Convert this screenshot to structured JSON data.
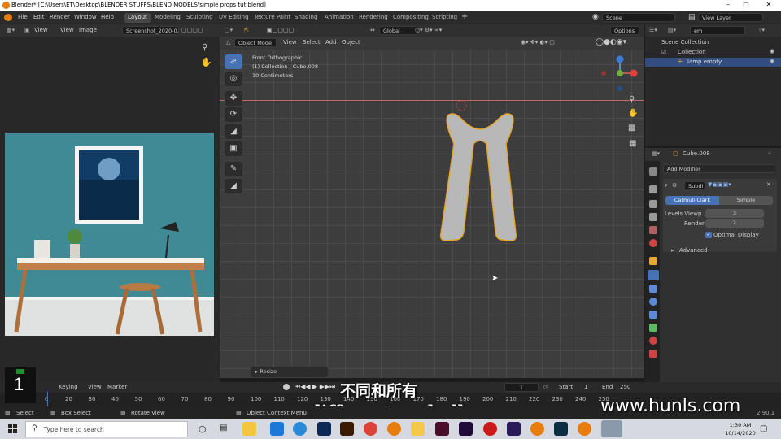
{
  "window": {
    "title": "Blender* [C:\\Users\\ET\\Desktop\\BLENDER STUFFS\\BLEND MODELS\\simple props tut.blend]"
  },
  "menu": [
    "File",
    "Edit",
    "Render",
    "Window",
    "Help"
  ],
  "workspaces": [
    "Layout",
    "Modeling",
    "Sculpting",
    "UV Editing",
    "Texture Paint",
    "Shading",
    "Animation",
    "Rendering",
    "Compositing",
    "Scripting"
  ],
  "scene": {
    "label": "Scene",
    "view_layer": "View Layer"
  },
  "image_editor": {
    "menus": [
      "View",
      "View",
      "Image"
    ],
    "image_name": "Screenshot_2020-0..."
  },
  "viewport": {
    "mode": "Object Mode",
    "menus": [
      "View",
      "Select",
      "Add",
      "Object"
    ],
    "orientation": "Global",
    "options": "Options",
    "info": [
      "Front Orthographic",
      "(1) Collection | Cube.008",
      "10 Centimeters"
    ],
    "operator": "Resize"
  },
  "outliner": {
    "search": "em",
    "items": [
      "Scene Collection",
      "Collection",
      "lamp empty"
    ]
  },
  "properties": {
    "object": "Cube.008",
    "add_modifier": "Add Modifier",
    "modifier": "Subdi",
    "tabs": [
      "Catmull-Clark",
      "Simple"
    ],
    "fields": [
      {
        "label": "Levels Viewp...",
        "value": "3"
      },
      {
        "label": "Render",
        "value": "2"
      }
    ],
    "optimal": "Optimal Display",
    "advanced": "Advanced"
  },
  "timeline": {
    "menus": [
      "Keying",
      "View",
      "Marker"
    ],
    "frame": "1",
    "start_label": "Start",
    "start": "1",
    "end_label": "End",
    "end": "250",
    "ticks": [
      "0",
      "20",
      "30",
      "40",
      "50",
      "60",
      "70",
      "80",
      "90",
      "100",
      "110",
      "120",
      "130",
      "140",
      "150",
      "160",
      "170",
      "180",
      "190",
      "200",
      "210",
      "220",
      "230",
      "240",
      "250"
    ],
    "overlay_frame": "1"
  },
  "status": {
    "select": "Select",
    "box": "Box Select",
    "rotate": "Rotate View",
    "context": "Object Context Menu",
    "version": "2.90.1"
  },
  "taskbar": {
    "search": "Type here to search",
    "time": "1:30 AM",
    "date": "10/14/2020"
  },
  "subtitles": {
    "chinese": "不同和所有",
    "english": "different and all."
  },
  "watermark": "www.hunls.com"
}
